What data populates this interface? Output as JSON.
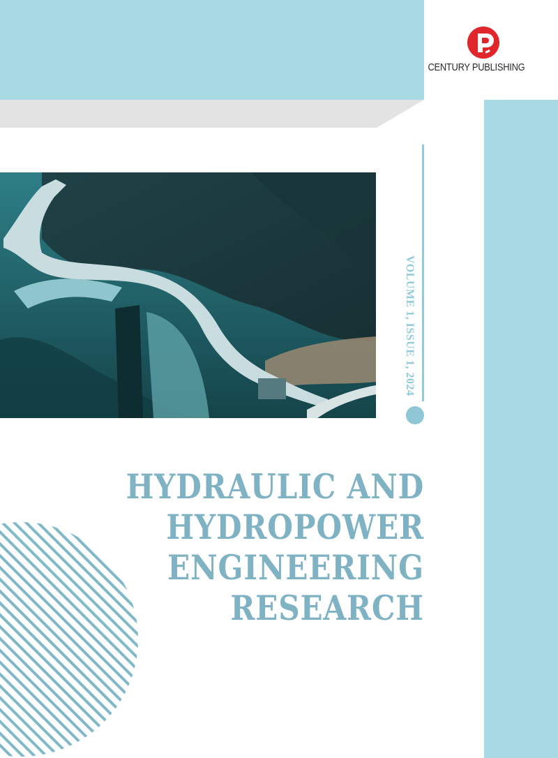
{
  "publisher": {
    "name": "CENTURY PUBLISHING",
    "logo_icon": "cp-logo-icon"
  },
  "journal": {
    "title_lines": [
      "HYDRAULIC AND",
      "HYDROPOWER",
      "ENGINEERING",
      "RESEARCH"
    ],
    "volume_issue": "VOLUME 1, ISSUE 1, 2024"
  },
  "cover_image": {
    "icon": "aerial-dam-photo"
  },
  "colors": {
    "accent": "#a8dae6",
    "title": "#7fb2c2",
    "logo_red": "#e0262b"
  }
}
